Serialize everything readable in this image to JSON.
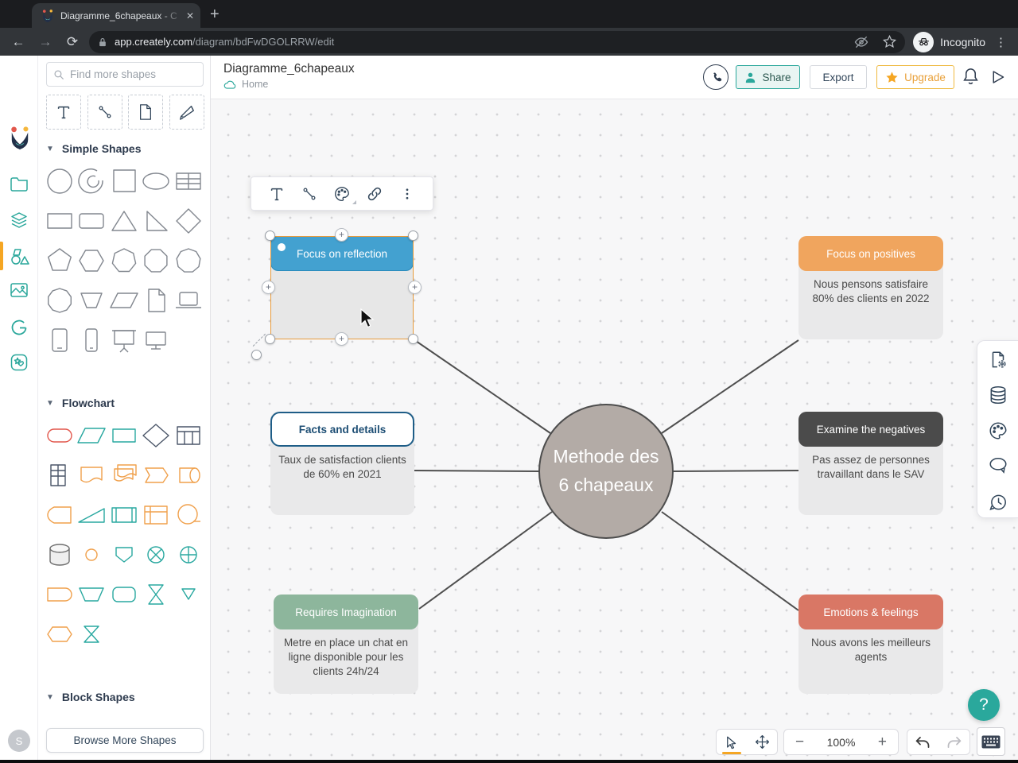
{
  "browser": {
    "tab_title": "Diagramme_6chapeaux - C",
    "close_glyph": "✕",
    "new_tab_glyph": "+",
    "back_glyph": "←",
    "forward_glyph": "→",
    "reload_glyph": "⟳",
    "url_domain": "app.creately.com",
    "url_path": "/diagram/bdFwDGOLRRW/edit",
    "incognito_label": "Incognito",
    "menu_glyph": "⋮"
  },
  "header": {
    "title": "Diagramme_6chapeaux",
    "breadcrumb": "Home",
    "share_label": "Share",
    "export_label": "Export",
    "upgrade_label": "Upgrade"
  },
  "sidebar": {
    "search_placeholder": "Find more shapes",
    "sections": [
      {
        "label": "Simple Shapes"
      },
      {
        "label": "Flowchart"
      },
      {
        "label": "Block Shapes"
      }
    ],
    "browse_more_label": "Browse More Shapes",
    "tool_icons": [
      "text-tool-icon",
      "connector-tool-icon",
      "page-tool-icon",
      "freehand-tool-icon"
    ],
    "palettes": {
      "simple": [
        [
          "circle",
          "g"
        ],
        [
          "loop",
          "g"
        ],
        [
          "square",
          "g"
        ],
        [
          "ellipse",
          "g"
        ],
        [
          "table",
          "g"
        ],
        [
          "rectangle",
          "g"
        ],
        [
          "rounded-rectangle",
          "g"
        ],
        [
          "triangle",
          "g"
        ],
        [
          "right-triangle",
          "g"
        ],
        [
          "diamond",
          "g"
        ],
        [
          "pentagon",
          "g"
        ],
        [
          "hexagon",
          "g"
        ],
        [
          "heptagon",
          "g"
        ],
        [
          "octagon",
          "g"
        ],
        [
          "nonagon",
          "g"
        ],
        [
          "decagon",
          "g"
        ],
        [
          "trapezoid-down",
          "g"
        ],
        [
          "parallelogram",
          "g"
        ],
        [
          "document",
          "g"
        ],
        [
          "laptop",
          "g"
        ],
        [
          "tablet",
          "g"
        ],
        [
          "mobile",
          "g"
        ],
        [
          "projector-screen",
          "g"
        ],
        [
          "monitor",
          "g"
        ]
      ],
      "flowchart": [
        [
          "terminator",
          "r"
        ],
        [
          "parallelogram",
          "t"
        ],
        [
          "process",
          "t"
        ],
        [
          "decision",
          "d"
        ],
        [
          "fc-table",
          "d"
        ],
        [
          "fc-grid",
          "d"
        ],
        [
          "fc-document",
          "o"
        ],
        [
          "multi-document",
          "o"
        ],
        [
          "stored-data",
          "o"
        ],
        [
          "direct-storage",
          "o"
        ],
        [
          "display",
          "o"
        ],
        [
          "manual-operation",
          "t"
        ],
        [
          "predefined-process",
          "t"
        ],
        [
          "internal-storage",
          "o"
        ],
        [
          "sequential-storage",
          "o"
        ],
        [
          "database",
          "k"
        ],
        [
          "connector-dot",
          "o"
        ],
        [
          "off-page",
          "t"
        ],
        [
          "summing-junction",
          "t"
        ],
        [
          "or-junction",
          "t"
        ],
        [
          "delay",
          "o"
        ],
        [
          "trapezoid",
          "t"
        ],
        [
          "card",
          "t"
        ],
        [
          "sort",
          "t"
        ],
        [
          "merge",
          "t"
        ],
        [
          "preparation",
          "o"
        ],
        [
          "collate",
          "t"
        ]
      ],
      "block": [
        [
          "block-caret",
          "g"
        ],
        [
          "block-corner",
          "g"
        ],
        [
          "block-bracket",
          "g"
        ],
        [
          "block-slash",
          "g"
        ],
        [
          "block-arc",
          "g"
        ]
      ]
    },
    "avatar_initial": "S"
  },
  "canvas": {
    "center": {
      "label": "Methode des 6 chapeaux"
    },
    "nodes": [
      {
        "title": "Focus on reflection",
        "body": "",
        "color": "#43a1d0",
        "selected": true
      },
      {
        "title": "Focus on positives",
        "body": "Nous pensons satisfaire 80% des clients en 2022",
        "color": "#f0a55e"
      },
      {
        "title": "Facts and details",
        "body": "Taux de satisfaction clients de 60% en 2021",
        "color": "#ffffff"
      },
      {
        "title": "Examine the negatives",
        "body": "Pas assez de personnes travaillant dans le SAV",
        "color": "#4b4b4b"
      },
      {
        "title": "Requires Imagination",
        "body": "Metre en place un chat en ligne disponible pour les clients 24h/24",
        "color": "#8db69c"
      },
      {
        "title": "Emotions & feelings",
        "body": "Nous avons les meilleurs agents",
        "color": "#d97765"
      }
    ],
    "floating_toolbar_icons": [
      "text-icon",
      "connector-icon",
      "palette-icon",
      "link-icon",
      "more-options-icon"
    ]
  },
  "right_panel_icons": [
    "diagram-settings-icon",
    "database-icon",
    "theme-palette-icon",
    "comment-icon",
    "history-icon"
  ],
  "bottom_toolbar": {
    "zoom_level": "100%",
    "minus_glyph": "−",
    "plus_glyph": "+"
  },
  "help": {
    "label": "?"
  },
  "colors": {
    "accent_teal": "#2aa79b",
    "upgrade_orange": "#f5a623",
    "selection_orange": "#e89b3c",
    "center_circle": "#b3aba6",
    "node_blue": "#43a1d0",
    "node_orange": "#f0a55e",
    "node_dark": "#4b4b4b",
    "node_green": "#8db69c",
    "node_red": "#d97765",
    "flowchart_red": "#e2574c",
    "flowchart_teal": "#29a8a0",
    "flowchart_orange": "#f0a04b"
  }
}
